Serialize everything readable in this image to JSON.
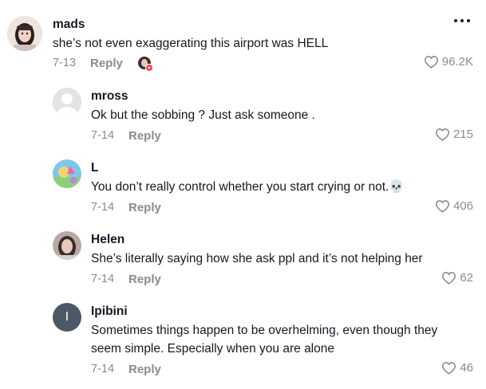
{
  "comments": [
    {
      "username": "mads",
      "text": "she’s not even exaggerating this airport was HELL",
      "date": "7-13",
      "reply": "Reply",
      "likes": "96.2K"
    },
    {
      "username": "mross",
      "text": "Ok but the sobbing ? Just ask someone .",
      "date": "7-14",
      "reply": "Reply",
      "likes": "215"
    },
    {
      "username": "L",
      "text": "You don’t really control whether you start crying or not.",
      "emoji": "💀",
      "date": "7-14",
      "reply": "Reply",
      "likes": "406"
    },
    {
      "username": "Helen",
      "text": "She’s literally saying how she ask ppl and it’s not helping her",
      "date": "7-14",
      "reply": "Reply",
      "likes": "62"
    },
    {
      "username": "Ipibini",
      "avatar_initial": "I",
      "text": "Sometimes things happen to be overhelming, even though they seem simple. Especially when you are alone",
      "date": "7-14",
      "reply": "Reply",
      "likes": "46"
    }
  ],
  "colors": {
    "muted": "#8a8b91",
    "text": "#161823",
    "creator_badge": "#fe2c55"
  },
  "icons": {
    "like": "heart-outline-icon",
    "more": "more-options-icon",
    "liked_by_creator": "creator-liked-badge-icon"
  }
}
